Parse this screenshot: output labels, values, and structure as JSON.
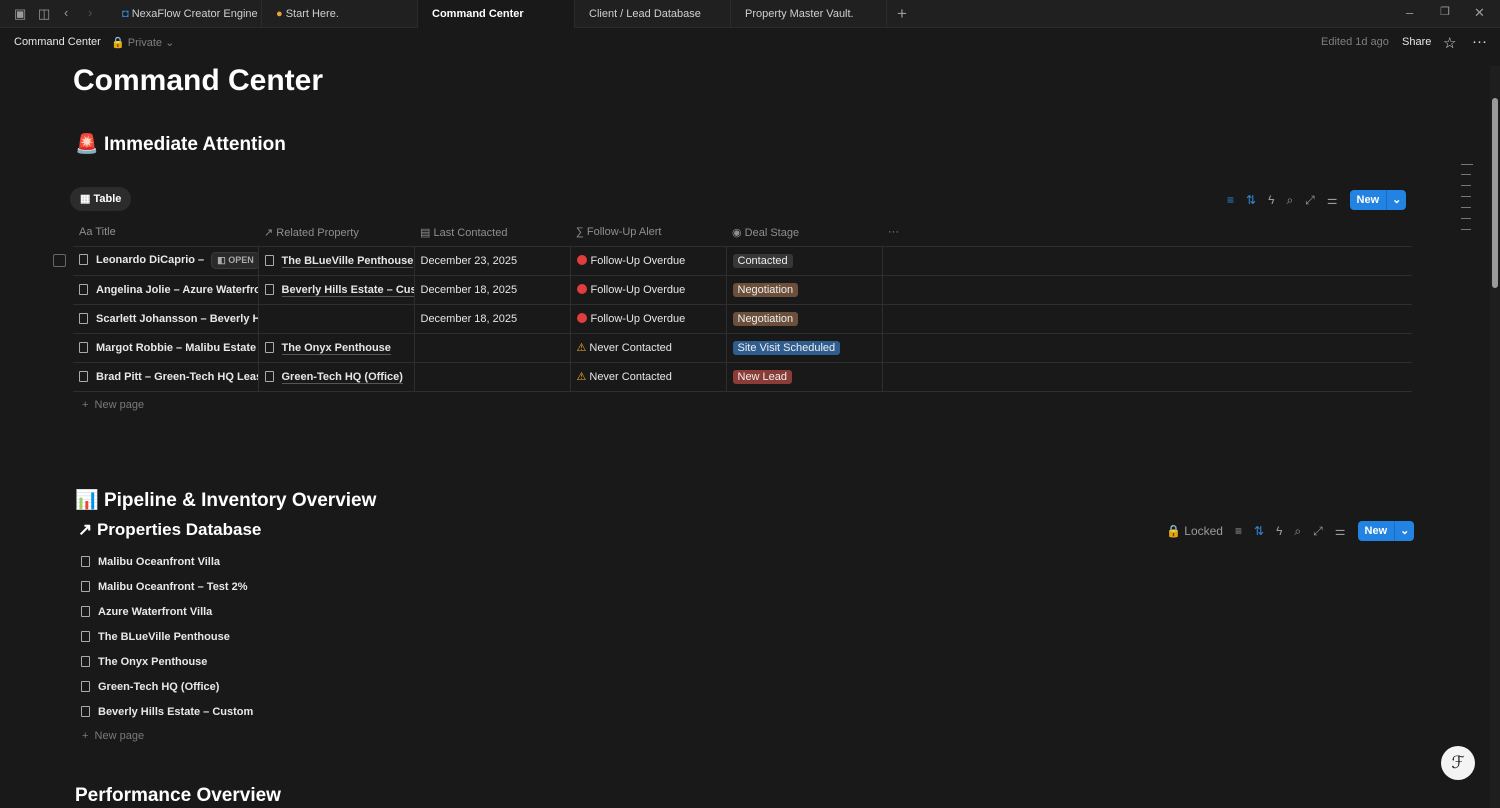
{
  "tabs": [
    {
      "label": "NexaFlow Creator Engine"
    },
    {
      "label": "Start Here."
    },
    {
      "label": "Command Center"
    },
    {
      "label": "Client / Lead Database"
    },
    {
      "label": "Property Master Vault."
    }
  ],
  "breadcrumb": {
    "page": "Command Center",
    "privacy": "Private"
  },
  "header": {
    "edited": "Edited 1d ago",
    "share": "Share"
  },
  "page_title": "Command Center",
  "section1": {
    "title": "Immediate Attention",
    "emoji": "🚨",
    "view": "Table",
    "new_label": "New",
    "columns": [
      "Title",
      "Related Property",
      "Last Contacted",
      "Follow-Up Alert",
      "Deal Stage"
    ],
    "open_label": "OPEN",
    "rows": [
      {
        "title": "Leonardo DiCaprio – ",
        "property": "The BLueVille Penthouse",
        "date": "December 23, 2025",
        "alert": "Follow-Up Overdue",
        "alert_type": "overdue",
        "stage": "Contacted",
        "stage_color": "#373737"
      },
      {
        "title": "Angelina Jolie – Azure Waterfront",
        "property": "Beverly Hills Estate – Custom",
        "date": "December 18, 2025",
        "alert": "Follow-Up Overdue",
        "alert_type": "overdue",
        "stage": "Negotiation",
        "stage_color": "#6b4f3a"
      },
      {
        "title": "Scarlett Johansson – Beverly Hills",
        "property": "",
        "date": "December 18, 2025",
        "alert": "Follow-Up Overdue",
        "alert_type": "overdue",
        "stage": "Negotiation",
        "stage_color": "#6b4f3a"
      },
      {
        "title": "Margot Robbie – Malibu Estate Inquiry",
        "property": "The Onyx Penthouse",
        "date": "",
        "alert": "Never Contacted",
        "alert_type": "warn",
        "stage": "Site Visit Scheduled",
        "stage_color": "#2f5d8f"
      },
      {
        "title": "Brad Pitt – Green-Tech HQ Lease",
        "property": "Green-Tech HQ (Office)",
        "date": "",
        "alert": "Never Contacted",
        "alert_type": "warn",
        "stage": "New Lead",
        "stage_color": "#8a3c36"
      }
    ],
    "new_page": "New page"
  },
  "section2": {
    "title": "Pipeline & Inventory Overview",
    "emoji": "📊",
    "db_title": "Properties Database",
    "locked": "Locked",
    "new_label": "New",
    "items": [
      "Malibu Oceanfront Villa",
      "Malibu Oceanfront – Test 2%",
      "Azure Waterfront Villa",
      "The BLueVille Penthouse",
      "The Onyx Penthouse",
      "Green-Tech HQ (Office)",
      "Beverly Hills Estate – Custom"
    ],
    "new_page": "New page"
  },
  "section3": {
    "title": "Performance Overview"
  }
}
